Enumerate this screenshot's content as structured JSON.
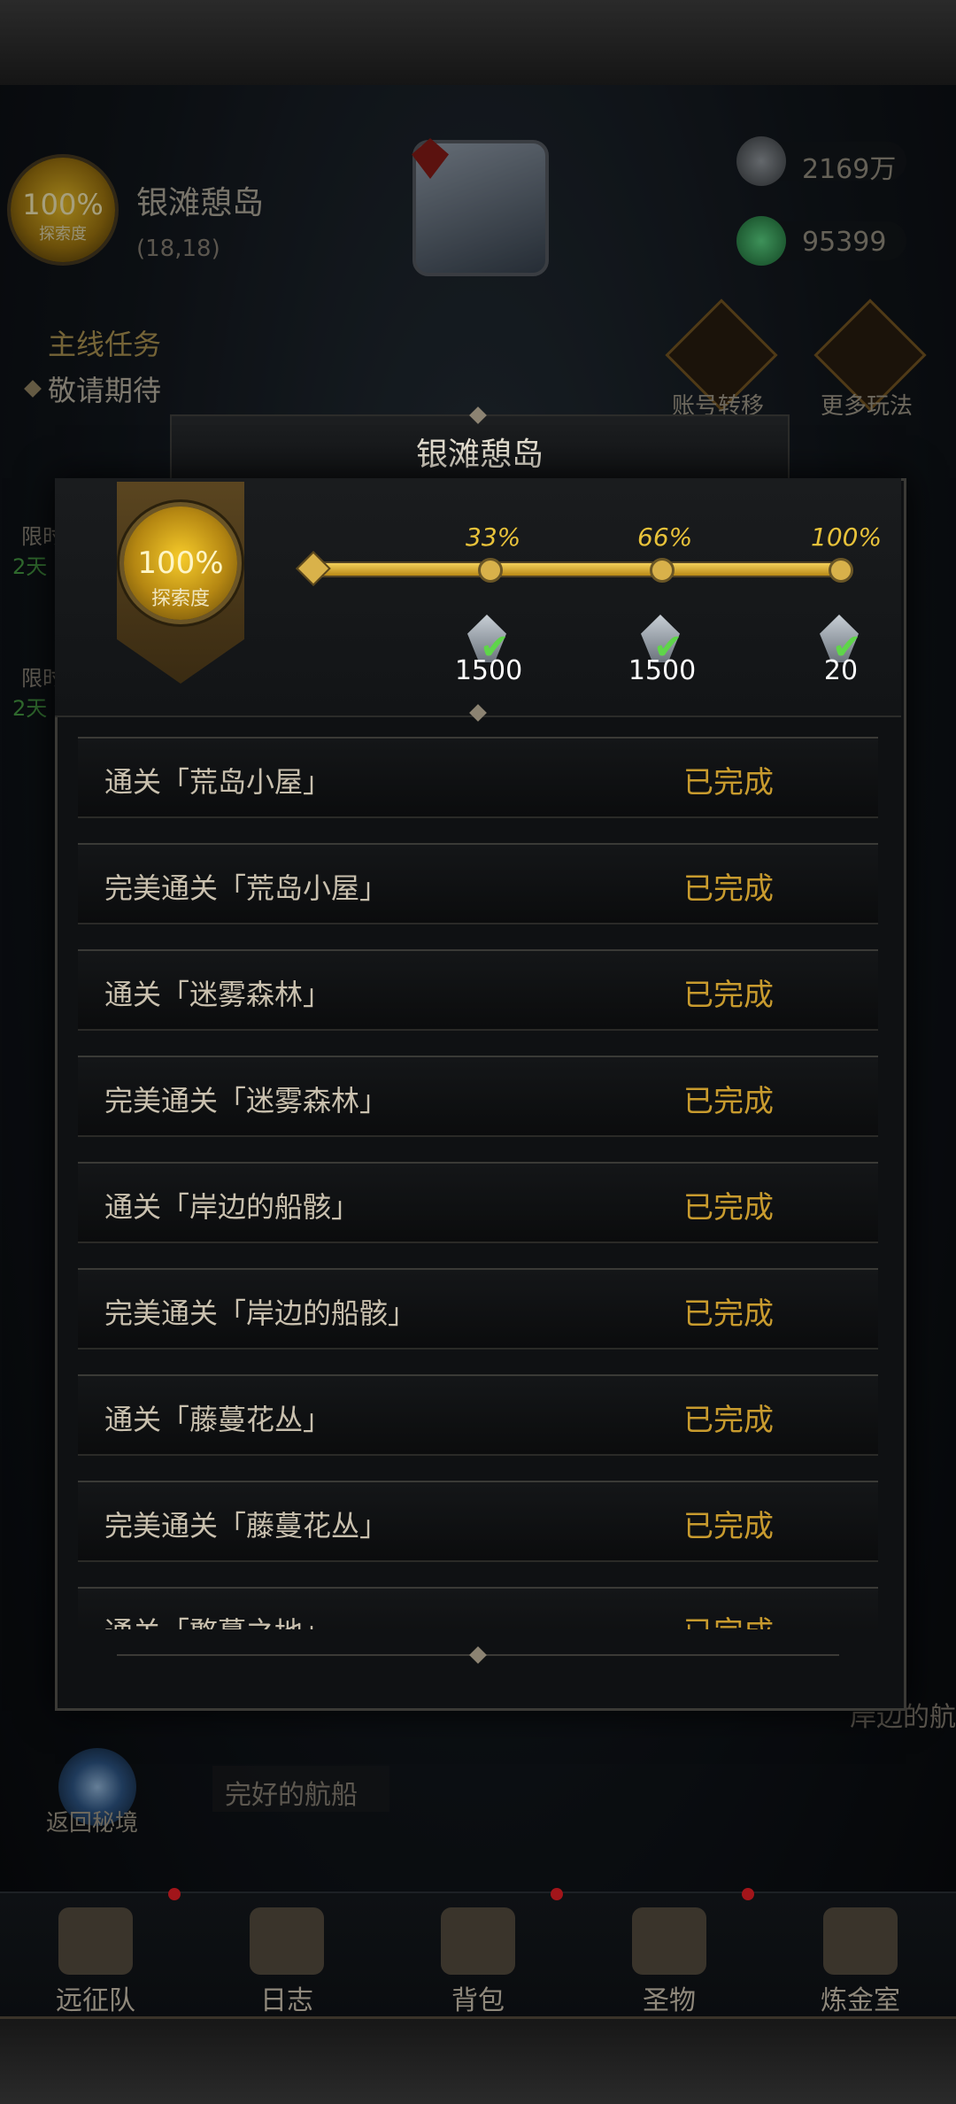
{
  "hud": {
    "explore_percent": "100%",
    "explore_label": "探索度",
    "island_name": "银滩憩岛",
    "coords": "(18,18)",
    "currency_silver": "2169万",
    "currency_gem": "95399",
    "main_quest_title": "主线任务",
    "main_quest_desc": "敬请期待",
    "account_transfer": "账号转移",
    "more_play": "更多玩法",
    "side_limit_1": "限时",
    "side_days_1": "2天",
    "side_limit_2": "限时",
    "side_days_2": "2天",
    "return_label": "返回秘境",
    "ship_label": "完好的航船",
    "right_node_label": "岸边的航"
  },
  "modal": {
    "title": "银滩憩岛",
    "explore_percent": "100%",
    "explore_label": "探索度",
    "progress_fraction": 1.0,
    "milestones": [
      {
        "pct_label": "33%",
        "amount": "1500",
        "claimed": true
      },
      {
        "pct_label": "66%",
        "amount": "1500",
        "claimed": true
      },
      {
        "pct_label": "100%",
        "amount": "20",
        "claimed": true
      }
    ],
    "tasks": [
      {
        "name": "通关「荒岛小屋」",
        "state": "已完成"
      },
      {
        "name": "完美通关「荒岛小屋」",
        "state": "已完成"
      },
      {
        "name": "通关「迷雾森林」",
        "state": "已完成"
      },
      {
        "name": "完美通关「迷雾森林」",
        "state": "已完成"
      },
      {
        "name": "通关「岸边的船骸」",
        "state": "已完成"
      },
      {
        "name": "完美通关「岸边的船骸」",
        "state": "已完成"
      },
      {
        "name": "通关「藤蔓花丛」",
        "state": "已完成"
      },
      {
        "name": "完美通关「藤蔓花丛」",
        "state": "已完成"
      },
      {
        "name": "通关「憨蔓之地」",
        "state": "已完成"
      }
    ]
  },
  "nav": [
    {
      "label": "远征队",
      "icon": "viking-helmet-icon",
      "badge": true
    },
    {
      "label": "日志",
      "icon": "scroll-log-icon",
      "badge": false
    },
    {
      "label": "背包",
      "icon": "backpack-icon",
      "badge": true
    },
    {
      "label": "圣物",
      "icon": "relic-flame-icon",
      "badge": true
    },
    {
      "label": "炼金室",
      "icon": "alchemy-icon",
      "badge": false
    }
  ],
  "colors": {
    "gold": "#c89b2e",
    "progress": "#e8c23a",
    "check": "#5fd54a",
    "badge": "#a2151a"
  }
}
